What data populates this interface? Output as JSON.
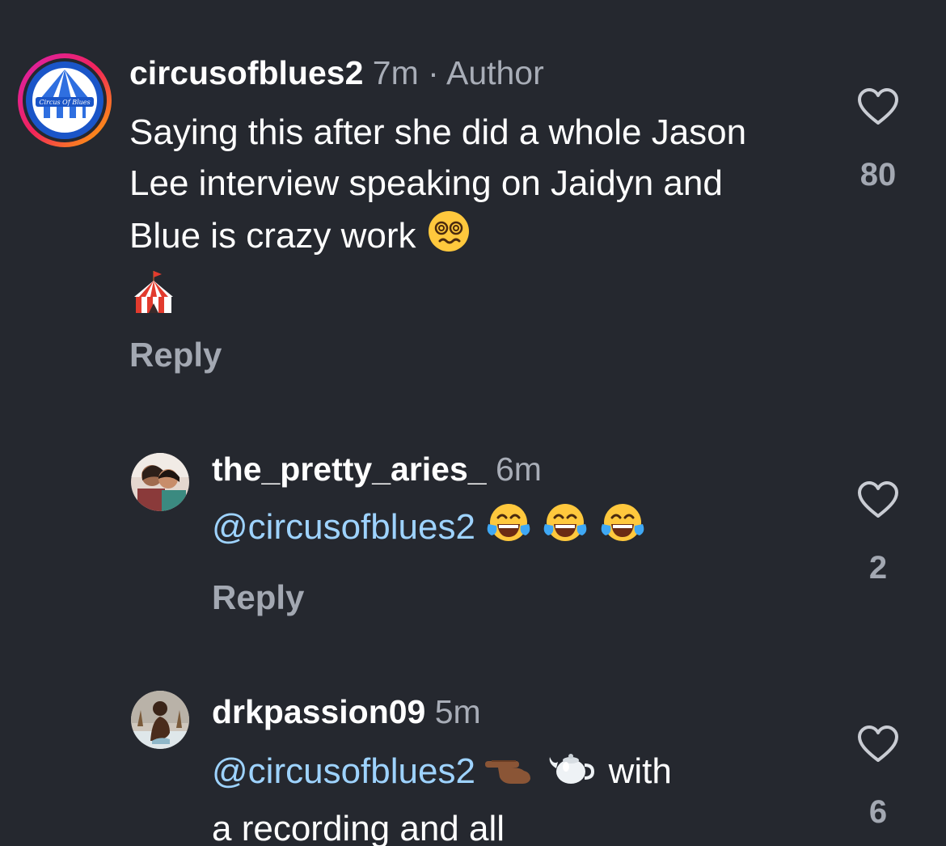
{
  "comments": [
    {
      "username": "circusofblues2",
      "time": "7m",
      "separator": "·",
      "badge": "Author",
      "text": "Saying this after she did a whole Jason Lee interview speaking on Jaidyn and Blue is crazy work",
      "emojis": [
        "woozy-face-icon",
        "circus-tent-icon"
      ],
      "reply_label": "Reply",
      "likes": "80",
      "avatar_ring": true
    },
    {
      "username": "the_pretty_aries_",
      "time": "6m",
      "mention": "@circusofblues2",
      "emojis": [
        "tears-of-joy-icon",
        "tears-of-joy-icon",
        "tears-of-joy-icon"
      ],
      "reply_label": "Reply",
      "likes": "2"
    },
    {
      "username": "drkpassion09",
      "time": "5m",
      "mention": "@circusofblues2",
      "emojis": [
        "pointing-left-hand-icon",
        "teapot-icon"
      ],
      "text_after_emojis": "with",
      "text_line2": "a recording and all",
      "likes": "6"
    }
  ],
  "colors": {
    "background": "#25282f",
    "mention": "#9ed3ff",
    "muted": "#a8adb7"
  }
}
